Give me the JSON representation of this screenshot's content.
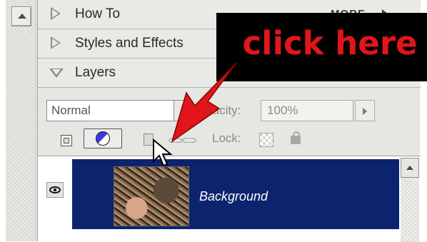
{
  "panel": {
    "sections": [
      {
        "label": "How To",
        "state": "collapsed"
      },
      {
        "label": "Styles and Effects",
        "state": "collapsed"
      },
      {
        "label": "Layers",
        "state": "expanded"
      }
    ],
    "more_label": "MORE"
  },
  "layers_panel": {
    "blend_mode": "Normal",
    "opacity_label": "Opacity:",
    "opacity_value": "100%",
    "lock_label": "Lock:"
  },
  "layers": [
    {
      "name": "Background",
      "visible": true,
      "locked": true,
      "selected": true
    }
  ],
  "annotation": {
    "callout_text": "click here",
    "callout_color": "#e0161b",
    "background_color": "#000000"
  },
  "colors": {
    "selected_row": "#0c246e",
    "panel_bg": "#e6e6e2"
  },
  "icons": [
    "new-set-icon",
    "adjustment-layer-icon",
    "trash-icon",
    "link-icon",
    "lock-transparency-icon",
    "lock-all-icon",
    "eye-icon",
    "layer-lock-icon",
    "cursor-arrow-icon"
  ]
}
